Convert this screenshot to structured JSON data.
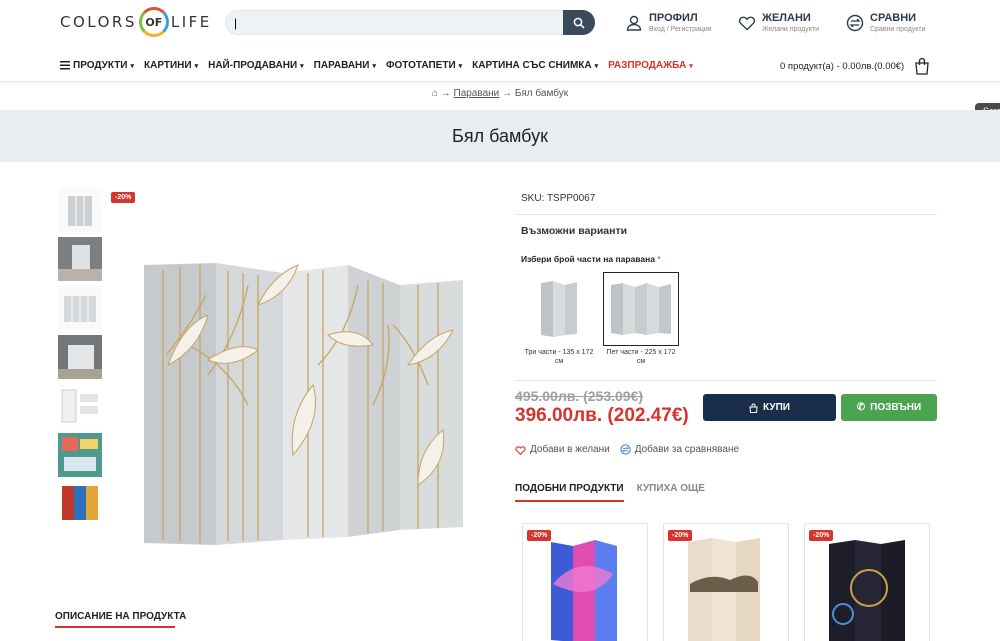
{
  "header": {
    "logo": {
      "left": "COLORS",
      "middle": "OF",
      "right": "LIFE"
    },
    "search": {
      "value": "|",
      "placeholder": ""
    },
    "links": [
      {
        "title": "ПРОФИЛ",
        "sub": "Вход / Регистрация",
        "icon": "user-icon"
      },
      {
        "title": "ЖЕЛАНИ",
        "sub": "Желани продукти",
        "icon": "heart-icon"
      },
      {
        "title": "СРАВНИ",
        "sub": "Сравни продукти",
        "icon": "compare-icon"
      }
    ]
  },
  "nav": {
    "items": [
      {
        "label": "ПРОДУКТИ",
        "icon": "menu-icon"
      },
      {
        "label": "КАРТИНИ"
      },
      {
        "label": "НАЙ-ПРОДАВАНИ"
      },
      {
        "label": "ПАРАВАНИ"
      },
      {
        "label": "ФОТОТАПЕТИ"
      },
      {
        "label": "КАРТИНА СЪС СНИМКА"
      },
      {
        "label": "РАЗПРОДАЖБА"
      }
    ],
    "cart": "0 продукт(а) - 0.00лв.(0.00€)"
  },
  "breadcrumb": {
    "arrow": "→",
    "link": "Паравани",
    "current": "Бял бамбук"
  },
  "tooltip": "Scre",
  "page": {
    "title": "Бял бамбук"
  },
  "gallery": {
    "badge": "-20%"
  },
  "product": {
    "sku_label": "SKU: TSPP0067",
    "variants_title": "Възможни варианти",
    "choose_label": "Избери брой части на паравана",
    "required_mark": "*",
    "options": [
      {
        "caption": "Три части - 135 x 172 см"
      },
      {
        "caption": "Пет части - 225 x 172 см"
      }
    ],
    "old_price": "495.00лв. (253.09€)",
    "new_price": "396.00лв. (202.47€)",
    "buy_label": "КУПИ",
    "call_label": "ПОЗВЪНИ",
    "wishlist_label": "Добави в желани",
    "compare_label": "Добави за сравняване",
    "tabs": [
      "ПОДОБНИ ПРОДУКТИ",
      "КУПИХА ОЩЕ"
    ]
  },
  "related": {
    "badges": [
      "-20%",
      "-20%",
      "-20%"
    ]
  },
  "description_tab": "ОПИСАНИЕ НА ПРОДУКТА",
  "colors": {
    "accent": "#d6342c",
    "navy": "#1a2d4b",
    "green": "#4ba34f",
    "band": "#e9edf0"
  }
}
